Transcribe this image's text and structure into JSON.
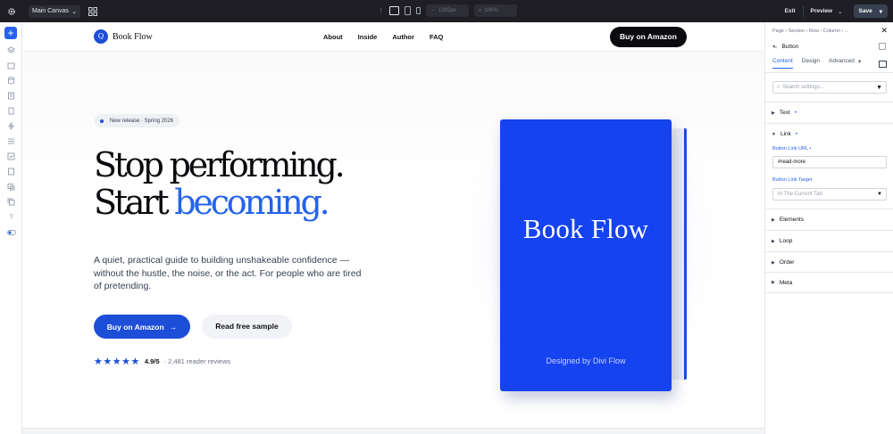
{
  "topbar": {
    "canvas_select": "Main Canvas",
    "width_value": "1392px",
    "zoom_value": "100%",
    "exit_label": "Exit",
    "preview_label": "Preview",
    "save_label": "Save"
  },
  "nav": {
    "logo_mark": "Q",
    "logo_text": "Book Flow",
    "links": [
      "About",
      "Inside",
      "Author",
      "FAQ"
    ],
    "cta": "Buy on Amazon"
  },
  "hero": {
    "badge": "New release · Spring 2026",
    "headline_line1": "Stop performing.",
    "headline_line2_plain": "Start ",
    "headline_line2_accent": "becoming.",
    "lead": "A quiet, practical guide to building unshakeable confidence — without the hustle, the noise, or the act. For people who are tired of pretending.",
    "primary_button": "Buy on Amazon",
    "primary_arrow": "→",
    "secondary_button": "Read free sample",
    "stars": "★★★★★",
    "score": "4.9/5",
    "reviews": "· 2,481 reader reviews"
  },
  "book": {
    "title": "Book Flow",
    "subtitle": "Designed by Divi Flow",
    "color": "#1543f0"
  },
  "panel": {
    "breadcrumb": "Page › Section › Row › Column › ...",
    "element_title": "Button",
    "tabs": [
      "Content",
      "Design",
      "Advanced"
    ],
    "search_placeholder": "Search settings...",
    "sections": {
      "text": "Text",
      "link": "Link",
      "elements": "Elements",
      "loop": "Loop",
      "order": "Order",
      "meta": "Meta"
    },
    "link_url_label": "Button Link URL",
    "link_url_value": "#read-more",
    "link_target_label": "Button Link Target",
    "link_target_value": "In The Current Tab"
  },
  "colors": {
    "accent": "#2563eb",
    "primary_button": "#1d4ed8",
    "topbar": "#1e1e24"
  }
}
